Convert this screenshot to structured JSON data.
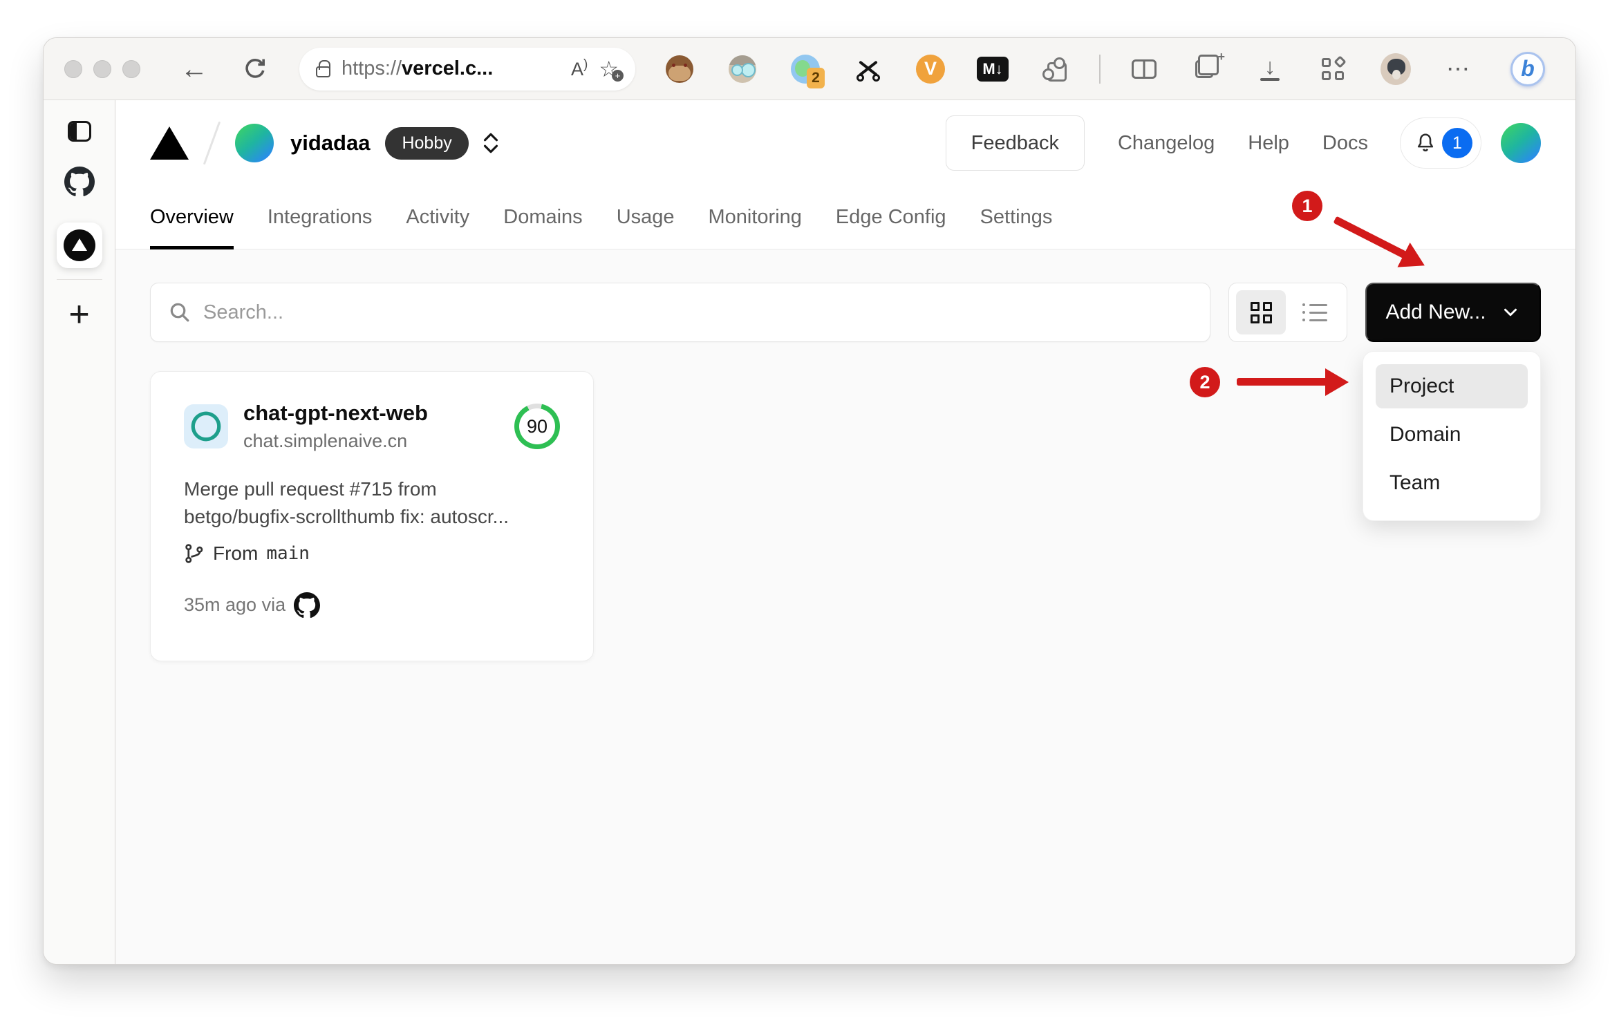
{
  "browser": {
    "back_glyph": "←",
    "url": {
      "scheme": "https://",
      "host": "vercel.c...",
      "reader_glyph": "A",
      "reader_paren": ")",
      "star_glyph": "☆",
      "star_plus": "+"
    },
    "extensions": {
      "badge_count": "2",
      "v_label": "V",
      "md_label": "M↓",
      "collections_plus": "+"
    },
    "download_glyph": "↓",
    "overflow_glyph": "⋯",
    "bing_label": "b"
  },
  "sidebar": {
    "new_tab_glyph": "+"
  },
  "dashboard": {
    "header": {
      "team_name": "yidadaa",
      "plan_badge": "Hobby",
      "nav": [
        "Feedback",
        "Changelog",
        "Help",
        "Docs"
      ],
      "notification_count": "1"
    },
    "tabs": [
      {
        "label": "Overview",
        "active": true
      },
      {
        "label": "Integrations",
        "active": false
      },
      {
        "label": "Activity",
        "active": false
      },
      {
        "label": "Domains",
        "active": false
      },
      {
        "label": "Usage",
        "active": false
      },
      {
        "label": "Monitoring",
        "active": false
      },
      {
        "label": "Edge Config",
        "active": false
      },
      {
        "label": "Settings",
        "active": false
      }
    ],
    "toolbar": {
      "search_placeholder": "Search...",
      "add_new_label": "Add New..."
    },
    "dropdown": {
      "items": [
        {
          "label": "Project",
          "highlighted": true
        },
        {
          "label": "Domain",
          "highlighted": false
        },
        {
          "label": "Team",
          "highlighted": false
        }
      ]
    },
    "project_card": {
      "name": "chat-gpt-next-web",
      "domain": "chat.simplenaive.cn",
      "score": "90",
      "commit_line1": "Merge pull request #715 from",
      "commit_line2": "betgo/bugfix-scrollthumb fix: autoscr...",
      "from_label": "From",
      "branch": "main",
      "deployed_label": "35m ago via"
    },
    "annotations": {
      "step1": "1",
      "step2": "2"
    }
  },
  "colors": {
    "annotation_red": "#d21a1a",
    "score_green": "#2ebf53",
    "notification_blue": "#0a6cf1",
    "button_black": "#0a0a0a",
    "plan_badge_bg": "#333333"
  }
}
